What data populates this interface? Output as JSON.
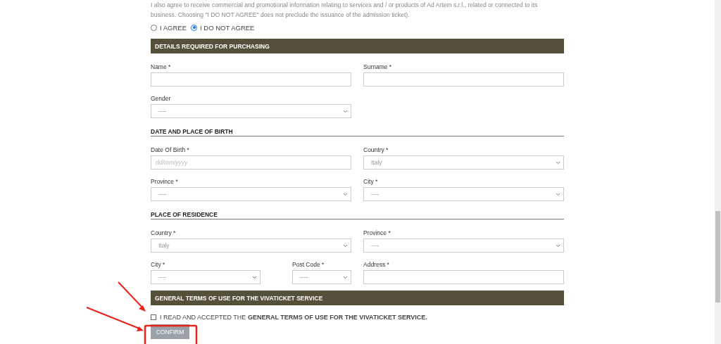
{
  "consent_text": "I also agree to receive commercial and promotional information relating to services and / or products of Ad Artem s.r.l., related or connected to its business. Choosing \"I DO NOT AGREE\" does not preclude the issuance of the admission ticket).",
  "consent_options": [
    {
      "label": "I AGREE",
      "selected": false
    },
    {
      "label": "I DO NOT AGREE",
      "selected": true
    }
  ],
  "sections": [
    {
      "kind": "bar",
      "title": "DETAILS REQUIRED FOR PURCHASING",
      "rows": [
        {
          "left": [
            {
              "label": "Name *",
              "kind": "input"
            }
          ],
          "right": [
            {
              "label": "Surname *",
              "kind": "input"
            }
          ]
        },
        {
          "left": [
            {
              "label": "Gender",
              "kind": "select",
              "value": "----"
            }
          ]
        }
      ]
    },
    {
      "kind": "heading",
      "title": "DATE AND PLACE OF BIRTH",
      "rows": [
        {
          "left": [
            {
              "label": "Date Of Birth *",
              "kind": "input",
              "placeholder": "dd/mm/yyyy"
            }
          ],
          "right": [
            {
              "label": "Country *",
              "kind": "select",
              "value": "Italy"
            }
          ]
        },
        {
          "left": [
            {
              "label": "Province *",
              "kind": "select",
              "value": "----"
            }
          ],
          "right": [
            {
              "label": "City *",
              "kind": "select",
              "value": "----"
            }
          ]
        }
      ]
    },
    {
      "kind": "heading",
      "title": "PLACE OF RESIDENCE",
      "rows": [
        {
          "left": [
            {
              "label": "Country *",
              "kind": "select",
              "value": "Italy"
            }
          ],
          "right": [
            {
              "label": "Province *",
              "kind": "select",
              "value": "----"
            }
          ]
        },
        {
          "left": [
            {
              "label": "City *",
              "kind": "select",
              "value": "----"
            },
            {
              "label": "Post Code *",
              "kind": "select",
              "value": "----"
            }
          ],
          "right": [
            {
              "label": "Address *",
              "kind": "input"
            }
          ]
        }
      ]
    },
    {
      "kind": "bar",
      "title": "GENERAL TERMS OF USE FOR THE VIVATICKET SERVICE"
    }
  ],
  "terms": {
    "checked": false,
    "text": "I READ AND ACCEPTED THE **GENERAL TERMS OF USE FOR THE VIVATICKET SERVICE.**"
  },
  "confirm_button": "CONFIRM"
}
